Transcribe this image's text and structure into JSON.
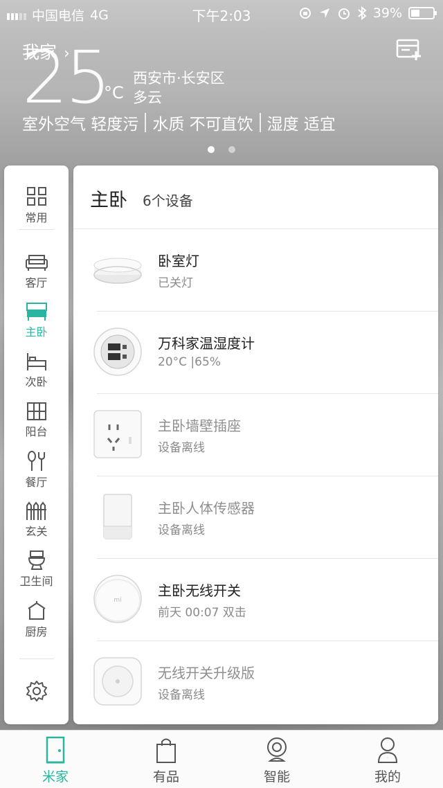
{
  "status_bar": {
    "carrier": "中国电信",
    "network": "4G",
    "time": "下午2:03",
    "battery": "39%"
  },
  "header": {
    "home_label": "我家",
    "temperature": "25",
    "unit": "°C",
    "location": "西安市·长安区",
    "condition": "多云",
    "metrics": [
      "室外空气 轻度污",
      "水质 不可直饮",
      "湿度 适宜"
    ]
  },
  "rooms": [
    {
      "label": "常用",
      "icon": "grid-icon"
    },
    {
      "label": "客厅",
      "icon": "sofa-icon"
    },
    {
      "label": "主卧",
      "icon": "bed-icon",
      "active": true
    },
    {
      "label": "次卧",
      "icon": "single-bed-icon"
    },
    {
      "label": "阳台",
      "icon": "balcony-icon"
    },
    {
      "label": "餐厅",
      "icon": "dining-icon"
    },
    {
      "label": "玄关",
      "icon": "fence-icon"
    },
    {
      "label": "卫生间",
      "icon": "toilet-icon"
    },
    {
      "label": "厨房",
      "icon": "pot-icon"
    }
  ],
  "panel": {
    "room_name": "主卧",
    "device_count": "6个设备"
  },
  "devices": [
    {
      "name": "卧室灯",
      "status": "已关灯",
      "icon": "ceiling-light-icon",
      "online": true
    },
    {
      "name": "万科家温湿度计",
      "status": "20°C |65%",
      "icon": "thermometer-icon",
      "online": true
    },
    {
      "name": "主卧墙壁插座",
      "status": "设备离线",
      "icon": "wall-socket-icon",
      "online": false
    },
    {
      "name": "主卧人体传感器",
      "status": "设备离线",
      "icon": "motion-sensor-icon",
      "online": false
    },
    {
      "name": "主卧无线开关",
      "status": "前天 00:07 双击",
      "icon": "wireless-switch-icon",
      "online": true
    },
    {
      "name": "无线开关升级版",
      "status": "设备离线",
      "icon": "square-switch-icon",
      "online": false
    }
  ],
  "tabs": [
    {
      "label": "米家",
      "icon": "door-icon",
      "active": true
    },
    {
      "label": "有品",
      "icon": "bag-icon"
    },
    {
      "label": "智能",
      "icon": "camera-icon"
    },
    {
      "label": "我的",
      "icon": "person-icon"
    }
  ],
  "colors": {
    "accent": "#29b5a2"
  }
}
